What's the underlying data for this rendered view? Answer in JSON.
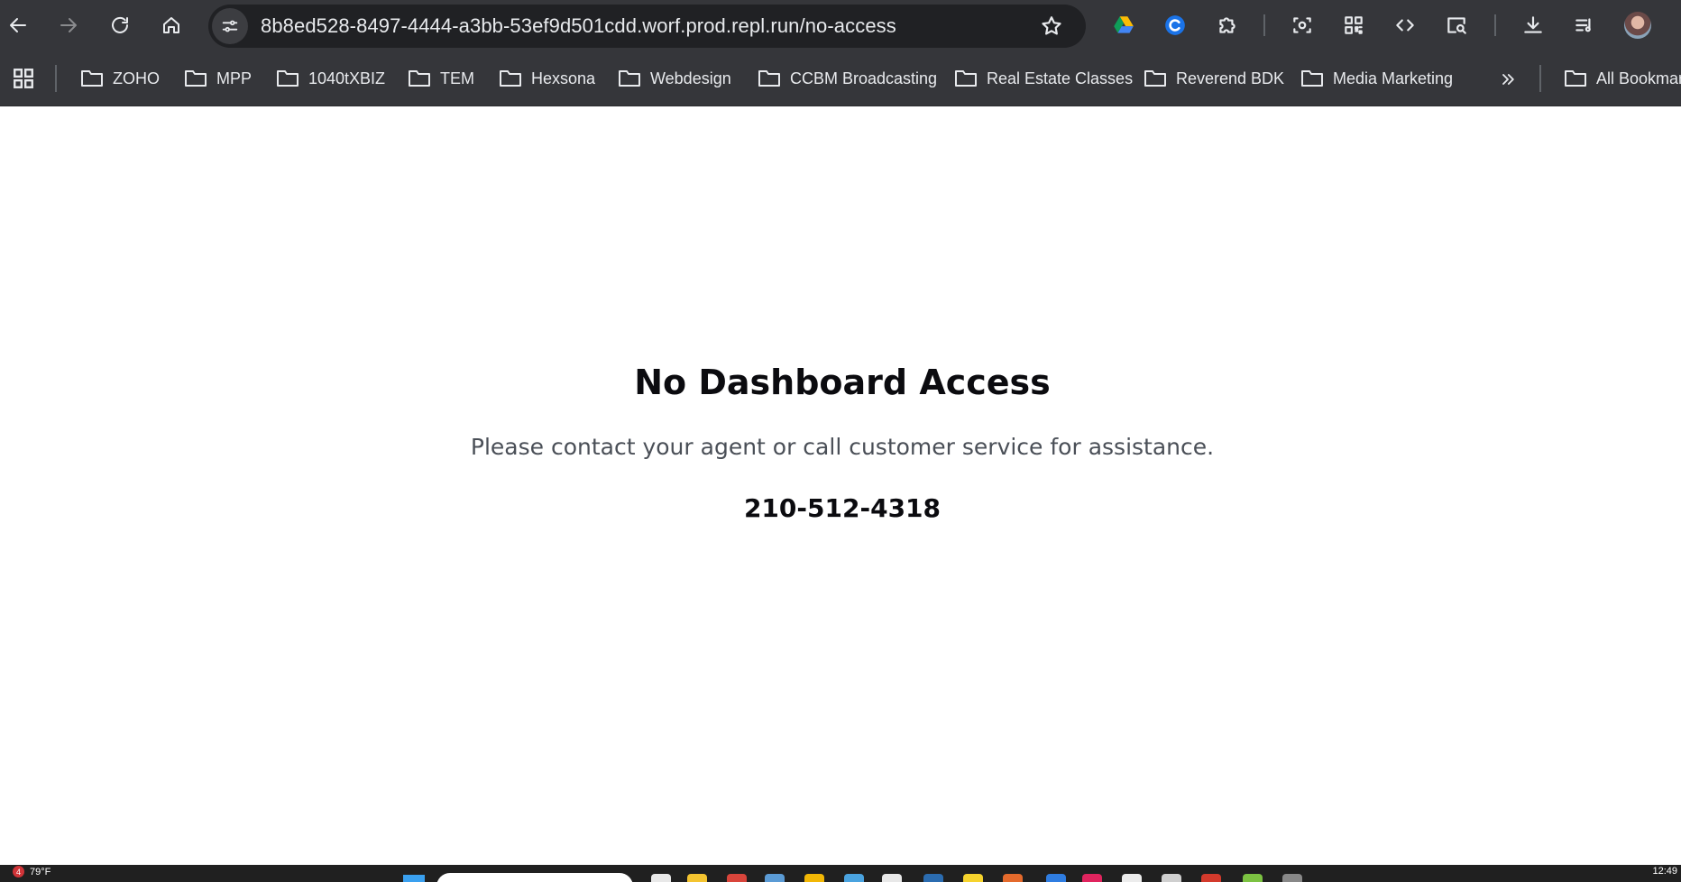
{
  "browser": {
    "url": "8b8ed528-8497-4444-a3bb-53ef9d501cdd.worf.prod.repl.run/no-access"
  },
  "icons": {
    "back": "arrow-left-icon",
    "forward": "arrow-right-icon",
    "reload": "reload-icon",
    "home": "home-icon",
    "site_info": "tune-icon",
    "bookmark": "star-icon",
    "extensions": [
      "google-drive-icon",
      "extension-c-icon",
      "puzzle-icon",
      "screenshot-icon",
      "qr-code-icon",
      "code-icon",
      "search-page-icon",
      "download-icon",
      "media-queue-icon",
      "profile-avatar"
    ]
  },
  "bookmarks": {
    "items": [
      "ZOHO",
      "MPP",
      "1040tXBIZ",
      "TEM",
      "Hexsona",
      "Webdesign",
      "CCBM Broadcasting",
      "Real Estate Classes",
      "Reverend BDK",
      "Media Marketing"
    ],
    "all_bookmarks": "All Bookmar"
  },
  "page": {
    "title": "No Dashboard Access",
    "message": "Please contact your agent or call customer service for assistance.",
    "phone": "210-512-4318"
  },
  "taskbar": {
    "badge": "4",
    "weather": "79°F",
    "clock": "12:49"
  },
  "colors": {
    "chrome_bg": "#35363a",
    "omnibox_bg": "#202124",
    "title_text": "#0b0b0f",
    "message_text": "#4a4f57"
  }
}
